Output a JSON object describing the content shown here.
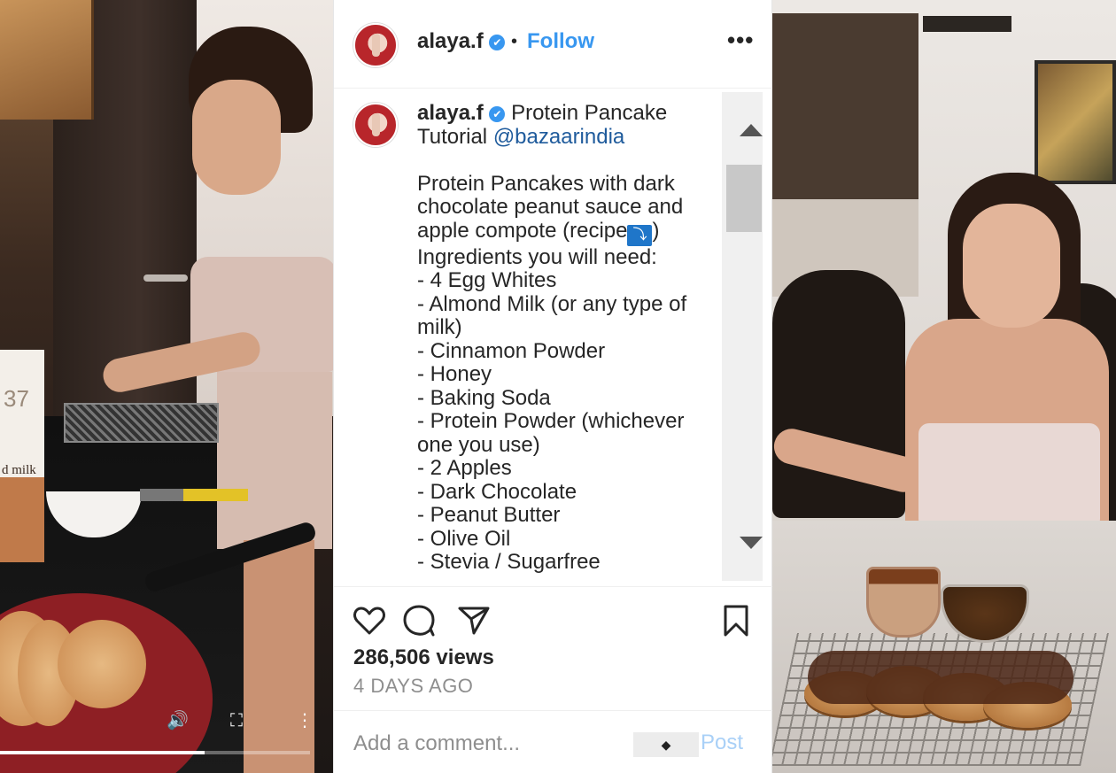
{
  "post": {
    "username": "alaya.f",
    "verified_mark": "✔",
    "separator": "•",
    "follow_label": "Follow",
    "more_label": "•••"
  },
  "caption": {
    "username": "alaya.f",
    "verified_mark": "✔",
    "title_text": "Protein Pancake Tutorial",
    "mention": "@bazaarindia",
    "body_intro": "Protein Pancakes with dark chocolate peanut sauce and apple compote (recipe",
    "down_emoji": "⤵",
    "body_close": ")",
    "ingredients_heading": "Ingredients you will need:",
    "ingredients": [
      "- 4 Egg Whites",
      "- Almond Milk (or any type of milk)",
      "- Cinnamon Powder",
      "- Honey",
      "- Baking Soda",
      "- Protein Powder (whichever one you use)",
      "- 2 Apples",
      "- Dark Chocolate",
      "- Peanut Butter",
      "- Olive Oil",
      "- Stevia / Sugarfree"
    ]
  },
  "actions": {
    "like_icon": "heart-outline",
    "comment_icon": "speech-bubble-outline",
    "share_icon": "paper-plane-outline",
    "save_icon": "bookmark-outline",
    "views": "286,506 views",
    "posted": "4 DAYS AGO"
  },
  "comment": {
    "placeholder": "Add a comment...",
    "emoji_label": "◆",
    "post_label": "Post"
  },
  "video_left": {
    "carton_label": "d milk",
    "carton_number": "37",
    "progress": 0.66,
    "volume_icon": "🔊",
    "fullscreen_icon": "⛶",
    "menu_icon": "⋮"
  },
  "colors": {
    "accent": "#3897f0",
    "text": "#262626",
    "muted": "#8e8e8e",
    "post_disabled": "#a9d0f7",
    "avatar_red": "#b8262b"
  }
}
